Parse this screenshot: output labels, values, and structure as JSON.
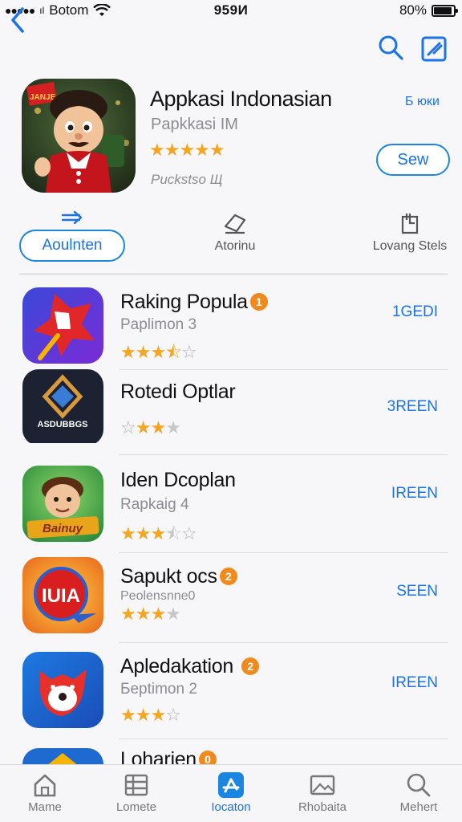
{
  "status_bar": {
    "carrier": "Botom",
    "time": "959И",
    "battery": "80%"
  },
  "featured": {
    "title": "Appkasi Indonasian",
    "subtitle": "Papkkasi IM",
    "rating_stars": 5,
    "meta": "Puckstso Щ",
    "top_link": "Б юки",
    "button_label": "Sew"
  },
  "actions": [
    {
      "label": "Aoulnten",
      "icon": "arrow-right-icon"
    },
    {
      "label": "Atorinu",
      "icon": "tag-icon"
    },
    {
      "label": "Lovang Stels",
      "icon": "chart-doc-icon"
    }
  ],
  "apps": [
    {
      "title": "Raking Popula",
      "badge": "1",
      "subtitle": "Paplimon 3",
      "rating": 3.5,
      "action": "1GEDI",
      "icon": "red-star-icon"
    },
    {
      "title": "Rotedi Optlar",
      "badge": "",
      "subtitle": "",
      "rating": 3,
      "action": "3REEN",
      "icon": "diamond-logo-icon",
      "icon_text": "ASDUBBGS"
    },
    {
      "title": "Iden Dcoplan",
      "badge": "",
      "subtitle": "Rapkaig 4",
      "rating": 3.5,
      "action": "IREEN",
      "icon": "cartoon-boy-icon",
      "icon_text": "Bainuy"
    },
    {
      "title": "Sapukt ocs",
      "badge": "2",
      "subtitle": "Peolensnne0",
      "rating": 3,
      "action": "SEEN",
      "icon": "red-circle-icon",
      "icon_text": "IUIA"
    },
    {
      "title": "Apledakation",
      "badge": "2",
      "subtitle": "Бeptimon 2",
      "rating": 3,
      "action": "IREEN",
      "icon": "red-fox-icon"
    },
    {
      "title": "Loharien",
      "badge": "0",
      "subtitle": "",
      "rating": 0,
      "action": "",
      "icon": "partial-icon"
    }
  ],
  "tabs": [
    {
      "label": "Mame",
      "icon": "home-icon",
      "active": false
    },
    {
      "label": "Lomete",
      "icon": "list-icon",
      "active": false
    },
    {
      "label": "Iocaton",
      "icon": "apps-icon",
      "active": true
    },
    {
      "label": "Rhobaita",
      "icon": "photo-icon",
      "active": false
    },
    {
      "label": "Mehert",
      "icon": "search-icon",
      "active": false
    }
  ],
  "colors": {
    "accent": "#1a73e8",
    "star": "#f4a623",
    "badge": "#f08a1c"
  }
}
